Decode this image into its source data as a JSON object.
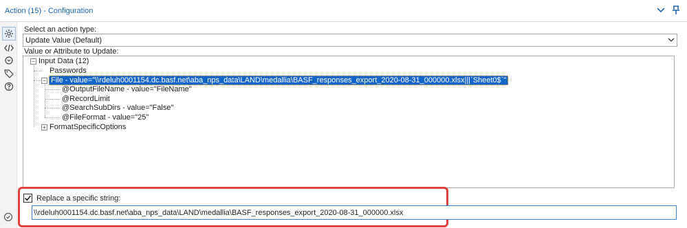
{
  "window": {
    "title": "Action (15) - Configuration"
  },
  "sidebar": {
    "more": "...",
    "icons": [
      "gear-icon",
      "code-icon",
      "refresh-icon",
      "tag-icon",
      "help-icon"
    ]
  },
  "action_type": {
    "label": "Select an action type:",
    "selected": "Update Value (Default)"
  },
  "value_attribute": {
    "label": "Value or Attribute to Update:"
  },
  "tree": {
    "root": "Input Data (12)",
    "passwords": "Passwords",
    "file": "File - value=\"\\\\rdeluh0001154.dc.basf.net\\aba_nps_data\\LAND\\medallia\\BASF_responses_export_2020-08-31_000000.xlsx|||`Sheet0$`\"",
    "children": [
      "@OutputFileName - value=\"FileName\"",
      "@RecordLimit",
      "@SearchSubDirs - value=\"False\"",
      "@FileFormat - value=\"25\""
    ],
    "format": "FormatSpecificOptions"
  },
  "replace": {
    "checked": true,
    "label": "Replace a specific string:",
    "value": "\\\\rdeluh0001154.dc.basf.net\\aba_nps_data\\LAND\\medallia\\BASF_responses_export_2020-08-31_000000.xlsx"
  },
  "colors": {
    "accent": "#1b66b3",
    "selection": "#1366c8",
    "highlight_border": "#e0413b"
  }
}
